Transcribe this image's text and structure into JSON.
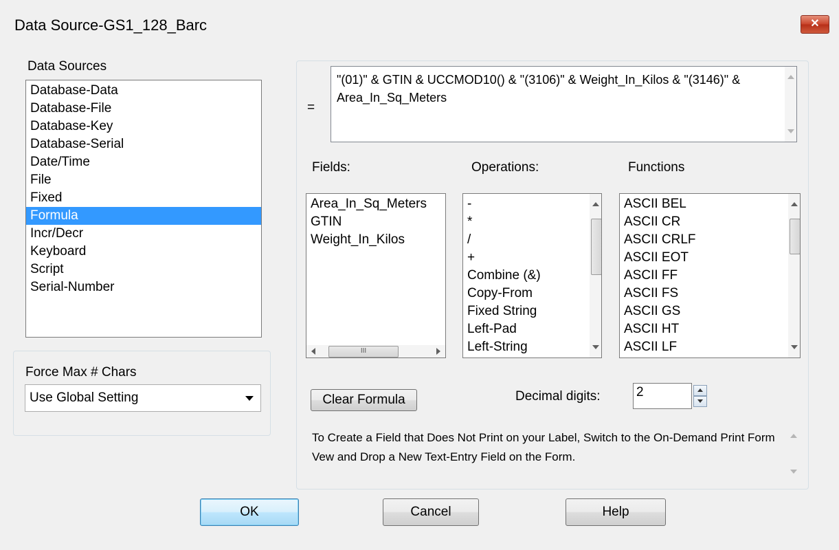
{
  "window": {
    "title": "Data Source-GS1_128_Barc",
    "close_glyph": "✕"
  },
  "data_sources": {
    "label": "Data Sources",
    "items": [
      {
        "label": "Database-Data"
      },
      {
        "label": "Database-File"
      },
      {
        "label": "Database-Key"
      },
      {
        "label": "Database-Serial"
      },
      {
        "label": "Date/Time"
      },
      {
        "label": "File"
      },
      {
        "label": "Fixed"
      },
      {
        "label": "Formula",
        "selected": true
      },
      {
        "label": "Incr/Decr"
      },
      {
        "label": "Keyboard"
      },
      {
        "label": "Script"
      },
      {
        "label": "Serial-Number"
      }
    ]
  },
  "force_max": {
    "label": "Force Max # Chars",
    "value": "Use Global Setting"
  },
  "formula": {
    "equals": "=",
    "text": "\"(01)\" & GTIN & UCCMOD10() & \"(3106)\" & Weight_In_Kilos & \"(3146)\" & Area_In_Sq_Meters"
  },
  "fields": {
    "label": "Fields:",
    "items": [
      "Area_In_Sq_Meters",
      "GTIN",
      "Weight_In_Kilos"
    ]
  },
  "operations": {
    "label": "Operations:",
    "items": [
      "-",
      "*",
      "/",
      "+",
      "Combine (&)",
      "Copy-From",
      "Fixed String",
      "Left-Pad",
      "Left-String"
    ]
  },
  "functions": {
    "label": "Functions",
    "items": [
      "ASCII BEL",
      "ASCII CR",
      "ASCII CRLF",
      "ASCII EOT",
      "ASCII FF",
      "ASCII FS",
      "ASCII GS",
      "ASCII HT",
      "ASCII LF"
    ]
  },
  "clear_formula_label": "Clear Formula",
  "decimal_digits": {
    "label": "Decimal digits:",
    "value": "2"
  },
  "help_text": "To Create a Field that Does Not Print on your Label, Switch to the On-Demand Print Form Vew and Drop a New Text-Entry Field on the Form.",
  "buttons": {
    "ok": "OK",
    "cancel": "Cancel",
    "help": "Help"
  },
  "colors": {
    "selection": "#3399ff",
    "close_button": "#c9432a",
    "dialog_bg": "#f0f0f0"
  }
}
